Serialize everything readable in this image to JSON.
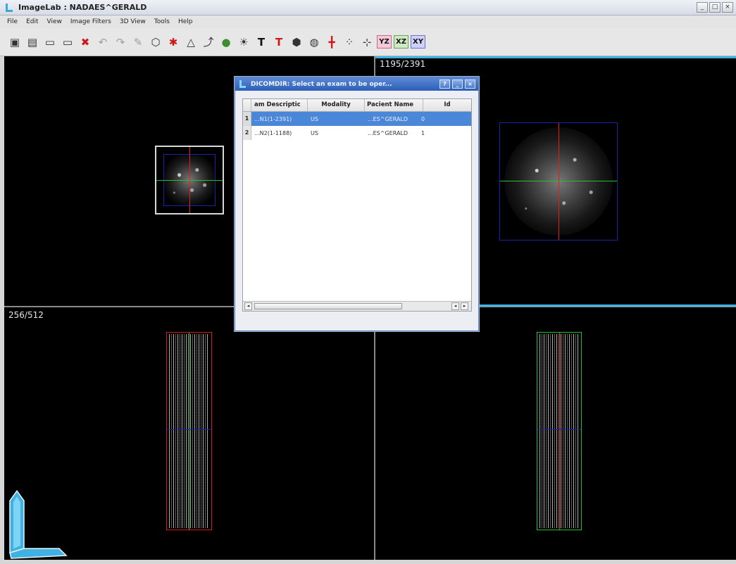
{
  "window": {
    "title": "ImageLab : NADAES^GERALD",
    "controls": [
      "_",
      "□",
      "×"
    ]
  },
  "menu": [
    "File",
    "Edit",
    "View",
    "Image Filters",
    "3D View",
    "Tools",
    "Help"
  ],
  "toolbar": {
    "plane_buttons": [
      "YZ",
      "XZ",
      "XY"
    ]
  },
  "viewports": {
    "top_right_label": "1195/2391",
    "bottom_left_label": "256/512"
  },
  "dialog": {
    "title": "DICOMDIR: Select an exam to be oper...",
    "buttons": [
      "?",
      "_",
      "×"
    ],
    "columns": [
      "am Descriptic",
      "Modality",
      "Pacient Name",
      "Id"
    ],
    "rows": [
      {
        "num": "1",
        "desc": "...N1(1-2391)",
        "modality": "US",
        "patient": "...ES^GERALD",
        "id": "0"
      },
      {
        "num": "2",
        "desc": "...N2(1-1188)",
        "modality": "US",
        "patient": "...ES^GERALD",
        "id": "1"
      }
    ]
  },
  "colors": {
    "accent_blue": "#3eb4e6",
    "selection": "#4b87d9",
    "crosshair_red": "#e11d1d",
    "crosshair_green": "#22c32a",
    "box_blue": "#1a22a8"
  }
}
